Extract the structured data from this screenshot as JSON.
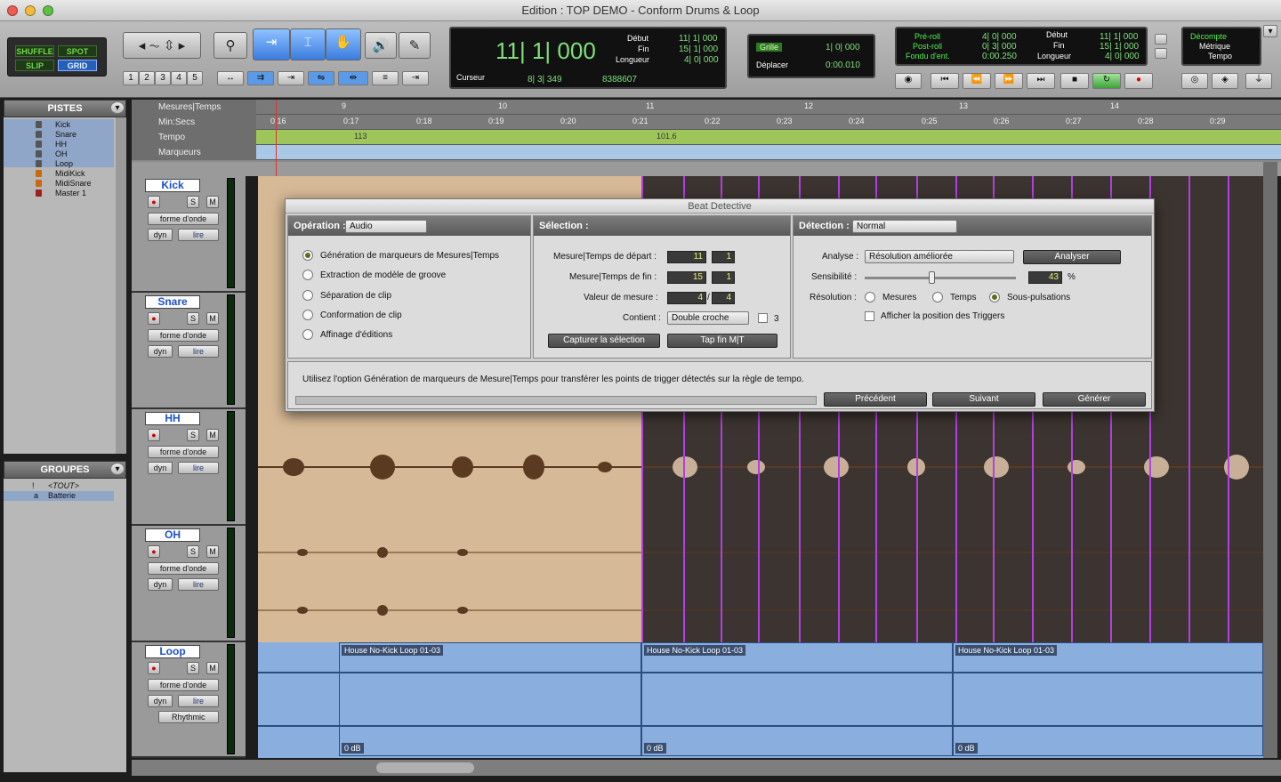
{
  "window": {
    "title": "Edition : TOP DEMO - Conform Drums & Loop"
  },
  "modes": {
    "shuffle": "SHUFFLE",
    "spot": "SPOT",
    "slip": "SLIP",
    "grid": "GRID"
  },
  "zoom_presets": [
    "1",
    "2",
    "3",
    "4",
    "5"
  ],
  "counter": {
    "main": "11| 1| 000",
    "debut_label": "Début",
    "fin_label": "Fin",
    "longueur_label": "Longueur",
    "debut": "11| 1| 000",
    "fin": "15| 1| 000",
    "longueur": "4| 0| 000",
    "curseur_label": "Curseur",
    "curseur": "8| 3| 349",
    "samples": "8388607"
  },
  "grid": {
    "grille_label": "Grille",
    "grille_value": "1| 0| 000",
    "deplacer_label": "Déplacer",
    "deplacer_value": "0:00.010"
  },
  "preroll": {
    "pre_label": "Pré-roll",
    "post_label": "Post-roll",
    "fondu_label": "Fondu d'ent.",
    "pre": "4| 0| 000",
    "post": "0| 3| 000",
    "fondu": "0:00.250",
    "debut_label": "Début",
    "fin_label": "Fin",
    "longueur_label": "Longueur",
    "debut": "11| 1| 000",
    "fin": "15| 1| 000",
    "longueur": "4| 0| 000"
  },
  "decompte": {
    "l1": "Décompte",
    "l2": "Métrique",
    "l3": "Tempo"
  },
  "pistes": {
    "title": "PISTES",
    "items": [
      "Kick",
      "Snare",
      "HH",
      "OH",
      "Loop",
      "MidiKick",
      "MidiSnare",
      "Master 1"
    ]
  },
  "groupes": {
    "title": "GROUPES",
    "items": [
      {
        "flag": "!",
        "name": "<TOUT>"
      },
      {
        "flag": "a",
        "name": "Batterie"
      }
    ]
  },
  "rulers": {
    "bars_label": "Mesures|Temps",
    "minsec_label": "Min:Secs",
    "tempo_label": "Tempo",
    "marqueurs_label": "Marqueurs",
    "bars": [
      "9",
      "10",
      "11",
      "12",
      "13",
      "14"
    ],
    "minsec": [
      "0:16",
      "0:17",
      "0:18",
      "0:19",
      "0:20",
      "0:21",
      "0:22",
      "0:23",
      "0:24",
      "0:25",
      "0:26",
      "0:27",
      "0:28",
      "0:29"
    ],
    "tempo_values": [
      "113",
      "101.6"
    ]
  },
  "tracks": [
    {
      "name": "Kick",
      "waveform": "forme d'onde",
      "dyn": "dyn",
      "lire": "lire"
    },
    {
      "name": "Snare",
      "waveform": "forme d'onde",
      "dyn": "dyn",
      "lire": "lire"
    },
    {
      "name": "HH",
      "waveform": "forme d'onde",
      "dyn": "dyn",
      "lire": "lire"
    },
    {
      "name": "OH",
      "waveform": "forme d'onde",
      "dyn": "dyn",
      "lire": "lire"
    },
    {
      "name": "Loop",
      "waveform": "forme d'onde",
      "dyn": "dyn",
      "lire": "lire",
      "plugin": "Rhythmic"
    }
  ],
  "loop_clips": [
    {
      "name": "House No-Kick Loop 01-03",
      "gain": "0 dB"
    },
    {
      "name": "House No-Kick Loop 01-03",
      "gain": "0 dB"
    },
    {
      "name": "House No-Kick Loop 01-03",
      "gain": "0 dB"
    }
  ],
  "beat_detective": {
    "title": "Beat Detective",
    "operation_label": "Opération :",
    "operation_value": "Audio",
    "operations": [
      "Génération de marqueurs de Mesures|Temps",
      "Extraction de modèle de groove",
      "Séparation de clip",
      "Conformation de clip",
      "Affinage d'éditions"
    ],
    "selection_label": "Sélection :",
    "start_label": "Mesure|Temps de départ :",
    "start_bar": "11",
    "start_beat": "1",
    "end_label": "Mesure|Temps de fin :",
    "end_bar": "15",
    "end_beat": "1",
    "meter_label": "Valeur de mesure :",
    "meter_num": "4",
    "meter_den": "4",
    "contains_label": "Contient :",
    "contains_value": "Double croche",
    "triplet": "3",
    "capture_btn": "Capturer la sélection",
    "tap_btn": "Tap fin M|T",
    "detection_label": "Détection :",
    "detection_value": "Normal",
    "analyse_label": "Analyse :",
    "analyse_value": "Résolution améliorée",
    "analyser_btn": "Analyser",
    "sensibilite_label": "Sensibilité :",
    "sensibilite_value": "43",
    "percent": "%",
    "resolution_label": "Résolution :",
    "res_mesures": "Mesures",
    "res_temps": "Temps",
    "res_sous": "Sous-pulsations",
    "triggers_label": "Afficher la position des Triggers",
    "help_text": "Utilisez l'option Génération de marqueurs de Mesure|Temps pour transférer les points de trigger détectés sur la règle de tempo.",
    "prev_btn": "Précédent",
    "next_btn": "Suivant",
    "gen_btn": "Générer"
  }
}
